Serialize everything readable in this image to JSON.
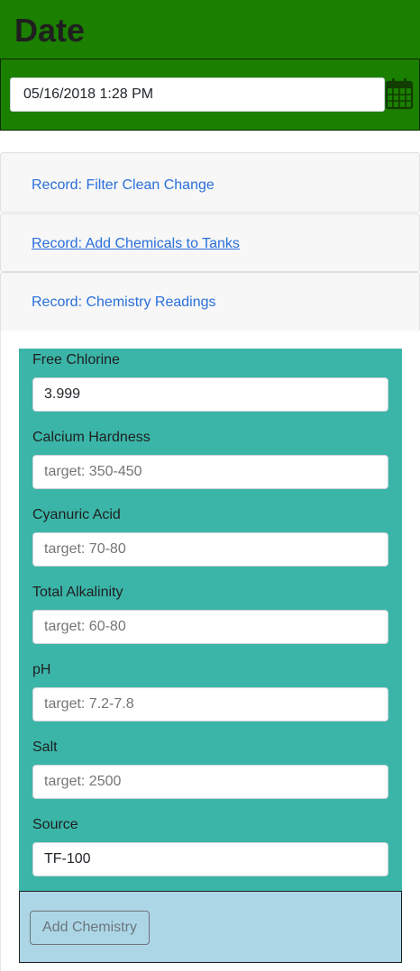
{
  "header": {
    "title": "Date"
  },
  "date_picker": {
    "value": "05/16/2018 1:28 PM",
    "icon": "calendar-icon"
  },
  "accordion": {
    "items": [
      {
        "label": "Record: Filter Clean Change"
      },
      {
        "label": "Record: Add Chemicals to Tanks"
      },
      {
        "label": "Record: Chemistry Readings"
      }
    ]
  },
  "chemistry": {
    "fields": [
      {
        "label": "Free Chlorine",
        "value": "3.999",
        "placeholder": ""
      },
      {
        "label": "Calcium Hardness",
        "value": "",
        "placeholder": "target: 350-450"
      },
      {
        "label": "Cyanuric Acid",
        "value": "",
        "placeholder": "target: 70-80"
      },
      {
        "label": "Total Alkalinity",
        "value": "",
        "placeholder": "target: 60-80"
      },
      {
        "label": "pH",
        "value": "",
        "placeholder": "target: 7.2-7.8"
      },
      {
        "label": "Salt",
        "value": "",
        "placeholder": "target: 2500"
      },
      {
        "label": "Source",
        "value": "TF-100",
        "placeholder": ""
      }
    ],
    "submit_label": "Add Chemistry"
  },
  "colors": {
    "header_green": "#1b7f00",
    "form_teal": "#3bb5a8",
    "footer_blue": "#acd6e6",
    "link_blue": "#2a6fdb"
  }
}
